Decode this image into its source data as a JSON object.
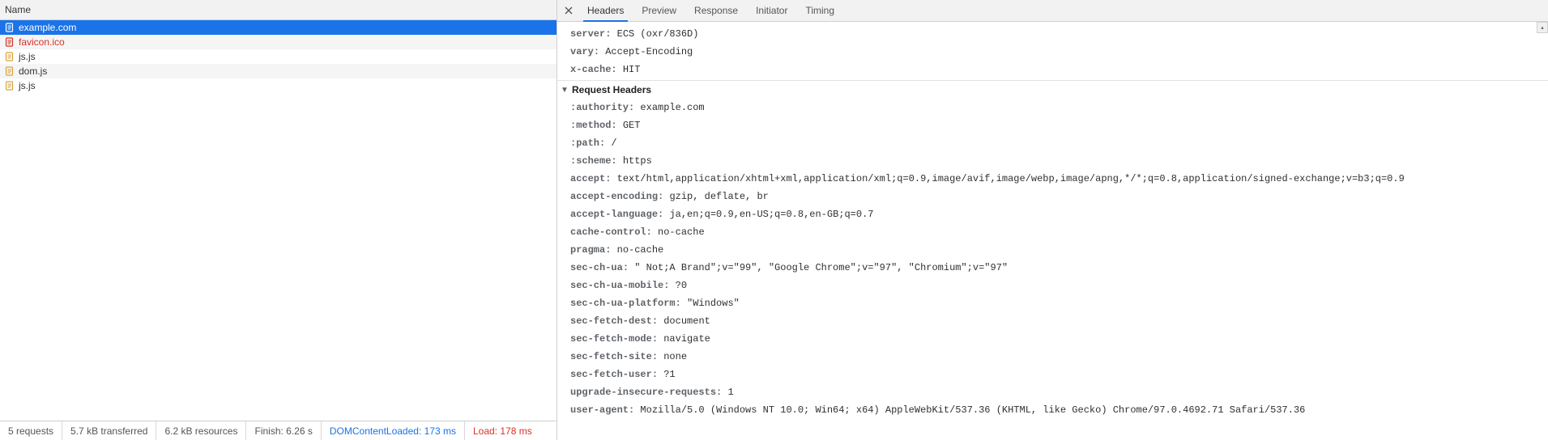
{
  "left": {
    "column_header": "Name",
    "requests": [
      {
        "name": "example.com",
        "kind": "document",
        "selected": true,
        "failed": false
      },
      {
        "name": "favicon.ico",
        "kind": "other",
        "selected": false,
        "failed": true
      },
      {
        "name": "js.js",
        "kind": "script",
        "selected": false,
        "failed": false
      },
      {
        "name": "dom.js",
        "kind": "script",
        "selected": false,
        "failed": false
      },
      {
        "name": "js.js",
        "kind": "script",
        "selected": false,
        "failed": false
      }
    ],
    "status": {
      "requests": "5 requests",
      "transferred": "5.7 kB transferred",
      "resources": "6.2 kB resources",
      "finish_label": "Finish:",
      "finish_value": "6.26 s",
      "dcl_label": "DOMContentLoaded:",
      "dcl_value": "173 ms",
      "load_label": "Load:",
      "load_value": "178 ms"
    }
  },
  "right": {
    "tabs": [
      "Headers",
      "Preview",
      "Response",
      "Initiator",
      "Timing"
    ],
    "active_tab": "Headers",
    "response_headers_trailing": [
      {
        "name": "server",
        "value": "ECS (oxr/836D)"
      },
      {
        "name": "vary",
        "value": "Accept-Encoding"
      },
      {
        "name": "x-cache",
        "value": "HIT"
      }
    ],
    "request_section_title": "Request Headers",
    "request_headers": [
      {
        "name": ":authority",
        "value": "example.com"
      },
      {
        "name": ":method",
        "value": "GET"
      },
      {
        "name": ":path",
        "value": "/"
      },
      {
        "name": ":scheme",
        "value": "https"
      },
      {
        "name": "accept",
        "value": "text/html,application/xhtml+xml,application/xml;q=0.9,image/avif,image/webp,image/apng,*/*;q=0.8,application/signed-exchange;v=b3;q=0.9"
      },
      {
        "name": "accept-encoding",
        "value": "gzip, deflate, br"
      },
      {
        "name": "accept-language",
        "value": "ja,en;q=0.9,en-US;q=0.8,en-GB;q=0.7"
      },
      {
        "name": "cache-control",
        "value": "no-cache"
      },
      {
        "name": "pragma",
        "value": "no-cache"
      },
      {
        "name": "sec-ch-ua",
        "value": "\" Not;A Brand\";v=\"99\", \"Google Chrome\";v=\"97\", \"Chromium\";v=\"97\""
      },
      {
        "name": "sec-ch-ua-mobile",
        "value": "?0"
      },
      {
        "name": "sec-ch-ua-platform",
        "value": "\"Windows\""
      },
      {
        "name": "sec-fetch-dest",
        "value": "document"
      },
      {
        "name": "sec-fetch-mode",
        "value": "navigate"
      },
      {
        "name": "sec-fetch-site",
        "value": "none"
      },
      {
        "name": "sec-fetch-user",
        "value": "?1"
      },
      {
        "name": "upgrade-insecure-requests",
        "value": "1"
      },
      {
        "name": "user-agent",
        "value": "Mozilla/5.0 (Windows NT 10.0; Win64; x64) AppleWebKit/537.36 (KHTML, like Gecko) Chrome/97.0.4692.71 Safari/537.36"
      }
    ]
  }
}
